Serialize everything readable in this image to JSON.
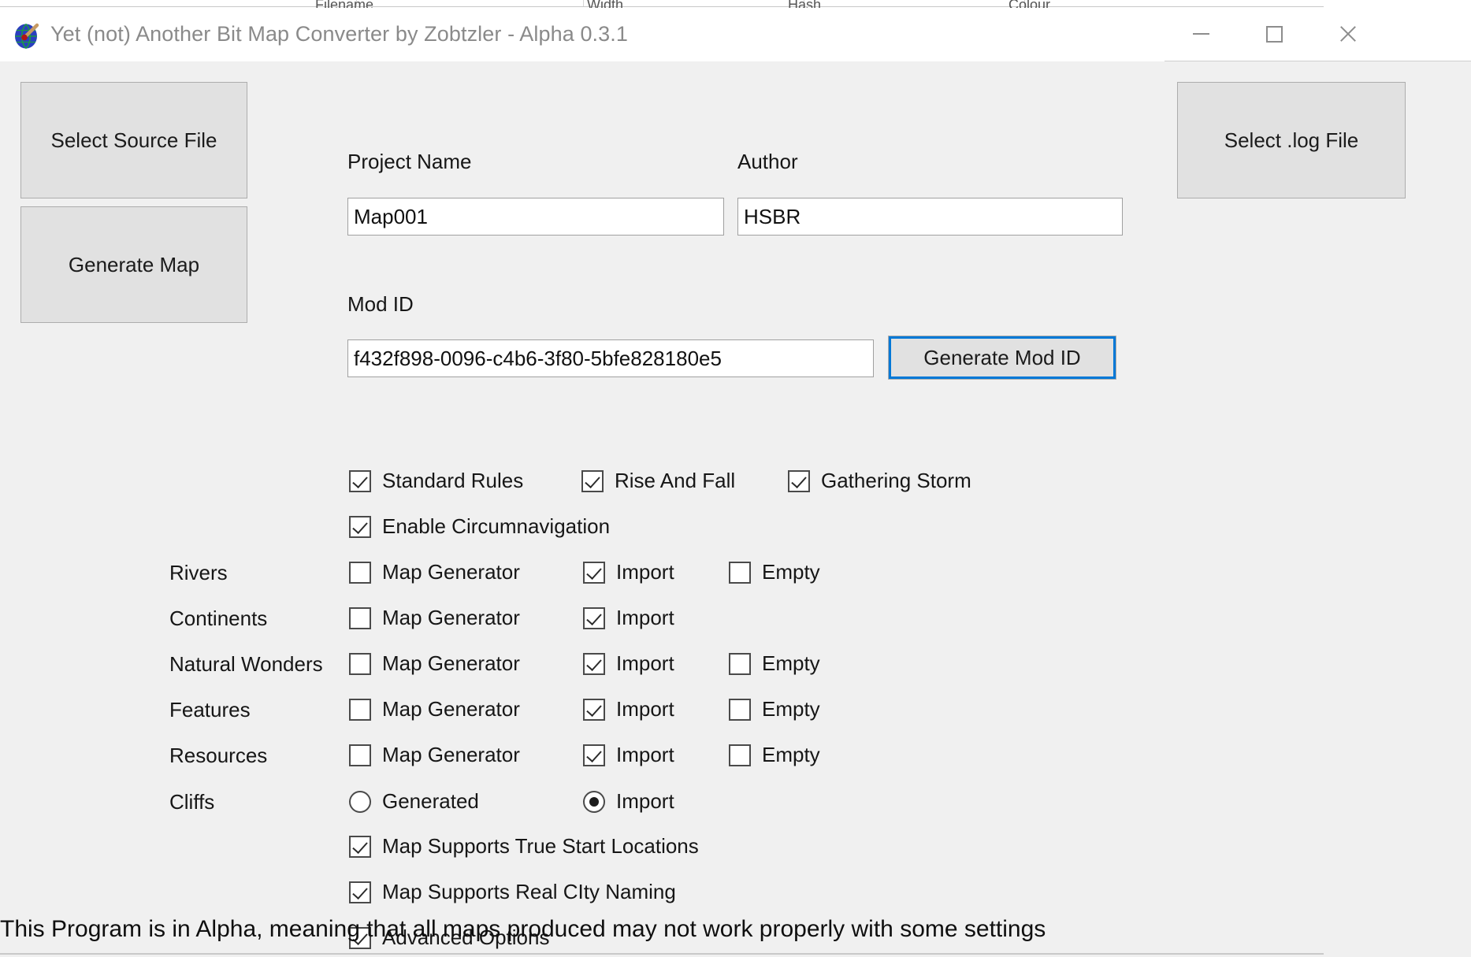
{
  "background_peek": {
    "labels": [
      "Filename",
      "Width",
      "Hash",
      "Colour"
    ]
  },
  "window": {
    "title": "Yet (not) Another Bit Map Converter by Zobtzler - Alpha 0.3.1",
    "icon": "globe-icon",
    "controls": {
      "minimize": "minimize-icon",
      "maximize": "maximize-icon",
      "close": "close-icon"
    }
  },
  "buttons": {
    "select_source_file": "Select Source File",
    "generate_map": "Generate Map",
    "select_log_file": "Select .log File",
    "generate_mod_id": "Generate Mod ID"
  },
  "fields": {
    "project_name": {
      "label": "Project Name",
      "value": "Map001"
    },
    "author": {
      "label": "Author",
      "value": "HSBR"
    },
    "mod_id": {
      "label": "Mod ID",
      "value": "f432f898-0096-c4b6-3f80-5bfe828180e5"
    }
  },
  "ruleset_options": [
    {
      "label": "Standard Rules",
      "checked": true
    },
    {
      "label": "Rise And Fall",
      "checked": true
    },
    {
      "label": "Gathering Storm",
      "checked": true
    }
  ],
  "circumnavigation": {
    "label": "Enable Circumnavigation",
    "checked": true
  },
  "source_rows": [
    {
      "name": "Rivers",
      "map_generator": {
        "label": "Map Generator",
        "checked": false
      },
      "import": {
        "label": "Import",
        "checked": true
      },
      "empty": {
        "label": "Empty",
        "checked": false
      }
    },
    {
      "name": "Continents",
      "map_generator": {
        "label": "Map Generator",
        "checked": false
      },
      "import": {
        "label": "Import",
        "checked": true
      },
      "empty": null
    },
    {
      "name": "Natural Wonders",
      "map_generator": {
        "label": "Map Generator",
        "checked": false
      },
      "import": {
        "label": "Import",
        "checked": true
      },
      "empty": {
        "label": "Empty",
        "checked": false
      }
    },
    {
      "name": "Features",
      "map_generator": {
        "label": "Map Generator",
        "checked": false
      },
      "import": {
        "label": "Import",
        "checked": true
      },
      "empty": {
        "label": "Empty",
        "checked": false
      }
    },
    {
      "name": "Resources",
      "map_generator": {
        "label": "Map Generator",
        "checked": false
      },
      "import": {
        "label": "Import",
        "checked": true
      },
      "empty": {
        "label": "Empty",
        "checked": false
      }
    }
  ],
  "cliffs": {
    "name": "Cliffs",
    "generated": {
      "label": "Generated",
      "selected": false
    },
    "import": {
      "label": "Import",
      "selected": true
    }
  },
  "bottom_options": [
    {
      "label": "Map Supports True Start Locations",
      "checked": true
    },
    {
      "label": "Map Supports Real CIty Naming",
      "checked": true
    },
    {
      "label": "Advanced Options",
      "checked": true
    }
  ],
  "status": "This Program is in Alpha, meaning that all maps produced may not work properly with some settings",
  "colors": {
    "window_bg": "#f0f0f0",
    "titlebar_bg": "#ffffff",
    "button_face": "#e1e1e1",
    "focus_ring": "#0078d7",
    "title_text": "#8a8a8a"
  }
}
